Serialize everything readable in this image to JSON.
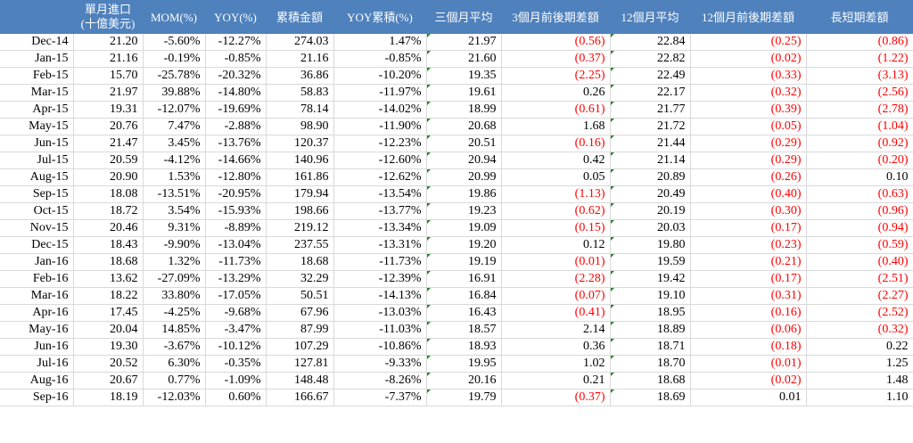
{
  "table": {
    "headers": {
      "date": "",
      "import_line1": "單月進口",
      "import_line2": "(十億美元)",
      "mom": "MOM(%)",
      "yoy": "YOY(%)",
      "cum": "累積金額",
      "yoy_cum": "YOY累積(%)",
      "avg3": "三個月平均",
      "diff3": "3個月前後期差額",
      "avg12": "12個月平均",
      "diff12": "12個月前後期差額",
      "long_short": "長短期差額"
    },
    "rows": [
      {
        "date": "Dec-14",
        "imp": "21.20",
        "mom": "-5.60%",
        "yoy": "-12.27%",
        "cum": "274.03",
        "yoycum": "1.47%",
        "avg3": "21.97",
        "diff3": "(0.56)",
        "avg12": "22.84",
        "diff12": "(0.25)",
        "ls": "(0.86)"
      },
      {
        "date": "Jan-15",
        "imp": "21.16",
        "mom": "-0.19%",
        "yoy": "-0.85%",
        "cum": "21.16",
        "yoycum": "-0.85%",
        "avg3": "21.60",
        "diff3": "(0.37)",
        "avg12": "22.82",
        "diff12": "(0.02)",
        "ls": "(1.22)"
      },
      {
        "date": "Feb-15",
        "imp": "15.70",
        "mom": "-25.78%",
        "yoy": "-20.32%",
        "cum": "36.86",
        "yoycum": "-10.20%",
        "avg3": "19.35",
        "diff3": "(2.25)",
        "avg12": "22.49",
        "diff12": "(0.33)",
        "ls": "(3.13)"
      },
      {
        "date": "Mar-15",
        "imp": "21.97",
        "mom": "39.88%",
        "yoy": "-14.80%",
        "cum": "58.83",
        "yoycum": "-11.97%",
        "avg3": "19.61",
        "diff3": "0.26",
        "avg12": "22.17",
        "diff12": "(0.32)",
        "ls": "(2.56)"
      },
      {
        "date": "Apr-15",
        "imp": "19.31",
        "mom": "-12.07%",
        "yoy": "-19.69%",
        "cum": "78.14",
        "yoycum": "-14.02%",
        "avg3": "18.99",
        "diff3": "(0.61)",
        "avg12": "21.77",
        "diff12": "(0.39)",
        "ls": "(2.78)"
      },
      {
        "date": "May-15",
        "imp": "20.76",
        "mom": "7.47%",
        "yoy": "-2.88%",
        "cum": "98.90",
        "yoycum": "-11.90%",
        "avg3": "20.68",
        "diff3": "1.68",
        "avg12": "21.72",
        "diff12": "(0.05)",
        "ls": "(1.04)"
      },
      {
        "date": "Jun-15",
        "imp": "21.47",
        "mom": "3.45%",
        "yoy": "-13.76%",
        "cum": "120.37",
        "yoycum": "-12.23%",
        "avg3": "20.51",
        "diff3": "(0.16)",
        "avg12": "21.44",
        "diff12": "(0.29)",
        "ls": "(0.92)"
      },
      {
        "date": "Jul-15",
        "imp": "20.59",
        "mom": "-4.12%",
        "yoy": "-14.66%",
        "cum": "140.96",
        "yoycum": "-12.60%",
        "avg3": "20.94",
        "diff3": "0.42",
        "avg12": "21.14",
        "diff12": "(0.29)",
        "ls": "(0.20)"
      },
      {
        "date": "Aug-15",
        "imp": "20.90",
        "mom": "1.53%",
        "yoy": "-12.80%",
        "cum": "161.86",
        "yoycum": "-12.62%",
        "avg3": "20.99",
        "diff3": "0.05",
        "avg12": "20.89",
        "diff12": "(0.26)",
        "ls": "0.10"
      },
      {
        "date": "Sep-15",
        "imp": "18.08",
        "mom": "-13.51%",
        "yoy": "-20.95%",
        "cum": "179.94",
        "yoycum": "-13.54%",
        "avg3": "19.86",
        "diff3": "(1.13)",
        "avg12": "20.49",
        "diff12": "(0.40)",
        "ls": "(0.63)"
      },
      {
        "date": "Oct-15",
        "imp": "18.72",
        "mom": "3.54%",
        "yoy": "-15.93%",
        "cum": "198.66",
        "yoycum": "-13.77%",
        "avg3": "19.23",
        "diff3": "(0.62)",
        "avg12": "20.19",
        "diff12": "(0.30)",
        "ls": "(0.96)"
      },
      {
        "date": "Nov-15",
        "imp": "20.46",
        "mom": "9.31%",
        "yoy": "-8.89%",
        "cum": "219.12",
        "yoycum": "-13.34%",
        "avg3": "19.09",
        "diff3": "(0.15)",
        "avg12": "20.03",
        "diff12": "(0.17)",
        "ls": "(0.94)"
      },
      {
        "date": "Dec-15",
        "imp": "18.43",
        "mom": "-9.90%",
        "yoy": "-13.04%",
        "cum": "237.55",
        "yoycum": "-13.31%",
        "avg3": "19.20",
        "diff3": "0.12",
        "avg12": "19.80",
        "diff12": "(0.23)",
        "ls": "(0.59)"
      },
      {
        "date": "Jan-16",
        "imp": "18.68",
        "mom": "1.32%",
        "yoy": "-11.73%",
        "cum": "18.68",
        "yoycum": "-11.73%",
        "avg3": "19.19",
        "diff3": "(0.01)",
        "avg12": "19.59",
        "diff12": "(0.21)",
        "ls": "(0.40)"
      },
      {
        "date": "Feb-16",
        "imp": "13.62",
        "mom": "-27.09%",
        "yoy": "-13.29%",
        "cum": "32.29",
        "yoycum": "-12.39%",
        "avg3": "16.91",
        "diff3": "(2.28)",
        "avg12": "19.42",
        "diff12": "(0.17)",
        "ls": "(2.51)"
      },
      {
        "date": "Mar-16",
        "imp": "18.22",
        "mom": "33.80%",
        "yoy": "-17.05%",
        "cum": "50.51",
        "yoycum": "-14.13%",
        "avg3": "16.84",
        "diff3": "(0.07)",
        "avg12": "19.10",
        "diff12": "(0.31)",
        "ls": "(2.27)"
      },
      {
        "date": "Apr-16",
        "imp": "17.45",
        "mom": "-4.25%",
        "yoy": "-9.68%",
        "cum": "67.96",
        "yoycum": "-13.03%",
        "avg3": "16.43",
        "diff3": "(0.41)",
        "avg12": "18.95",
        "diff12": "(0.16)",
        "ls": "(2.52)"
      },
      {
        "date": "May-16",
        "imp": "20.04",
        "mom": "14.85%",
        "yoy": "-3.47%",
        "cum": "87.99",
        "yoycum": "-11.03%",
        "avg3": "18.57",
        "diff3": "2.14",
        "avg12": "18.89",
        "diff12": "(0.06)",
        "ls": "(0.32)"
      },
      {
        "date": "Jun-16",
        "imp": "19.30",
        "mom": "-3.67%",
        "yoy": "-10.12%",
        "cum": "107.29",
        "yoycum": "-10.86%",
        "avg3": "18.93",
        "diff3": "0.36",
        "avg12": "18.71",
        "diff12": "(0.18)",
        "ls": "0.22"
      },
      {
        "date": "Jul-16",
        "imp": "20.52",
        "mom": "6.30%",
        "yoy": "-0.35%",
        "cum": "127.81",
        "yoycum": "-9.33%",
        "avg3": "19.95",
        "diff3": "1.02",
        "avg12": "18.70",
        "diff12": "(0.01)",
        "ls": "1.25"
      },
      {
        "date": "Aug-16",
        "imp": "20.67",
        "mom": "0.77%",
        "yoy": "-1.09%",
        "cum": "148.48",
        "yoycum": "-8.26%",
        "avg3": "20.16",
        "diff3": "0.21",
        "avg12": "18.68",
        "diff12": "(0.02)",
        "ls": "1.48"
      },
      {
        "date": "Sep-16",
        "imp": "18.19",
        "mom": "-12.03%",
        "yoy": "0.60%",
        "cum": "166.67",
        "yoycum": "-7.37%",
        "avg3": "19.79",
        "diff3": "(0.37)",
        "avg12": "18.69",
        "diff12": "0.01",
        "ls": "1.10"
      }
    ]
  },
  "colors": {
    "header_bg": "#4f81bd",
    "header_text": "#ffffff",
    "negative_text": "#ff0000",
    "gridline": "#d9d9d9",
    "error_indicator": "#1f8a1f"
  }
}
